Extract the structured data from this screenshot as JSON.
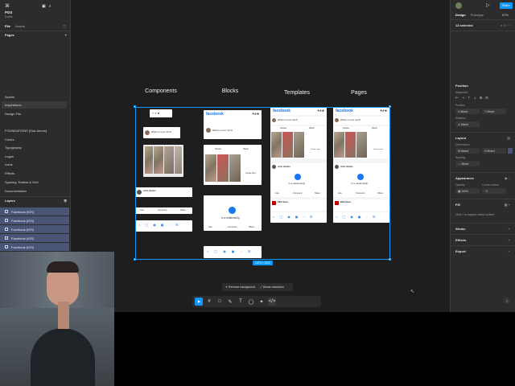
{
  "left_panel": {
    "file_name": "POS",
    "file_status": "Drafts",
    "tabs": [
      "File",
      "Assets"
    ],
    "pages_header": "Pages",
    "pages": [
      "Assets",
      "Inspirations",
      "Design File",
      "FOUNDATIONS [Sub-Atoms]",
      "Colors",
      "Typography",
      "Logos",
      "Icons",
      "Effects",
      "Spacing, Radius & Grid",
      "Documentation"
    ],
    "layers_header": "Layers",
    "layers": [
      "Facebook (IOS)",
      "Facebook (IOS)",
      "Facebook (IOS)",
      "Facebook (IOS)",
      "Facebook (IOS)"
    ]
  },
  "right_panel": {
    "share_label": "Share",
    "tabs": [
      "Design",
      "Prototype"
    ],
    "zoom": "57%",
    "selection": "13 selected",
    "position_header": "Position",
    "alignment_label": "Alignment",
    "position_label": "Position",
    "x_value": "Mixed",
    "y_value": "Mixed",
    "rotation_label": "Rotation",
    "rotation_value": "Mixed",
    "layout_header": "Layout",
    "dimensions_label": "Dimensions",
    "w_value": "Mixed",
    "h_value": "Mixed",
    "spacing_label": "Spacing",
    "spacing_value": "Mixed",
    "appearance_header": "Appearance",
    "opacity_label": "Opacity",
    "opacity_value": "100%",
    "corner_label": "Corner radius",
    "corner_value": "0",
    "fill_header": "Fill",
    "fill_hint": "Click + to replace mixed content",
    "stroke_header": "Stroke",
    "effects_header": "Effects",
    "export_header": "Export"
  },
  "canvas": {
    "columns": [
      "Components",
      "Blocks",
      "Templates",
      "Pages"
    ],
    "facebook_label": "facebook",
    "composer_placeholder": "What's on your mind?",
    "stories_tab": "Stories",
    "reels_tab": "Reels",
    "create_story": "Create story",
    "poster_name": "John Holden",
    "relationship_text": "In a relationship",
    "like_label": "Like",
    "comment_label": "Comment",
    "share_label": "Share",
    "news_title": "BBC News",
    "selection_size": "1673 × 1022"
  },
  "ai_bar": {
    "remove_bg": "Remove background",
    "boost": "Boost resolution"
  }
}
